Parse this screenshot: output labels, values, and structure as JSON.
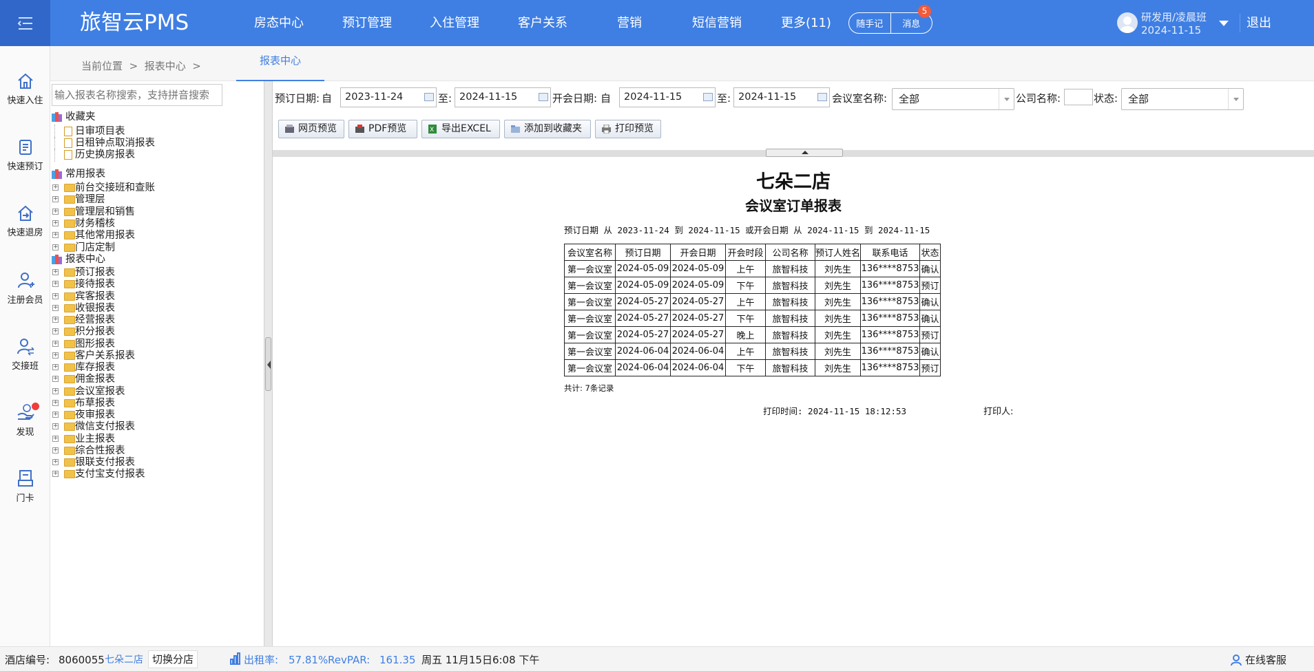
{
  "header": {
    "logo": "旅智云PMS",
    "nav": [
      "房态中心",
      "预订管理",
      "入住管理",
      "客户关系",
      "营销",
      "短信营销",
      "更多(11)"
    ],
    "memo_label": "随手记",
    "message_label": "消息",
    "message_badge": "5",
    "user_name": "研发用/凌晨班",
    "user_date": "2024-11-15",
    "logout_label": "退出",
    "accent_color": "#3f7fe3"
  },
  "quick_actions": [
    "快速入住",
    "快速预订",
    "快速退房",
    "注册会员",
    "交接班",
    "发现",
    "门卡"
  ],
  "breadcrumb": {
    "prefix": "当前位置",
    "sep": ">",
    "current": "报表中心",
    "tab": "报表中心"
  },
  "tree": {
    "search_placeholder": "输入报表名称搜索，支持拼音搜索",
    "favorites": {
      "label": "收藏夹",
      "items": [
        "日审项目表",
        "日租钟点取消报表",
        "历史换房报表"
      ]
    },
    "common": {
      "label": "常用报表",
      "items": [
        "前台交接班和查账",
        "管理层",
        "管理层和销售",
        "财务稽核",
        "其他常用报表",
        "门店定制"
      ]
    },
    "center": {
      "label": "报表中心",
      "items": [
        "预订报表",
        "接待报表",
        "宾客报表",
        "收银报表",
        "经营报表",
        "积分报表",
        "图形报表",
        "客户关系报表",
        "库存报表",
        "佣金报表",
        "会议室报表",
        "布草报表",
        "夜审报表",
        "微信支付报表",
        "业主报表",
        "综合性报表",
        "银联支付报表",
        "支付宝支付报表"
      ]
    }
  },
  "filters": {
    "booking_date_label": "预订日期:",
    "from_label": "自",
    "to_label": "至:",
    "booking_from": "2023-11-24",
    "booking_to": "2024-11-15",
    "meeting_date_label": "开会日期:",
    "meeting_from": "2024-11-15",
    "meeting_to": "2024-11-15",
    "room_label": "会议室名称:",
    "room_value": "全部",
    "company_label": "公司名称:",
    "company_value": "",
    "status_label": "状态:",
    "status_value": "全部"
  },
  "buttons": {
    "web_preview": "网页预览",
    "pdf_preview": "PDF预览",
    "export_excel": "导出EXCEL",
    "add_favorite": "添加到收藏夹",
    "print_preview": "打印预览"
  },
  "report": {
    "hotel": "七朵二店",
    "title": "会议室订单报表",
    "condition": "预订日期 从 2023-11-24 到 2024-11-15 或开会日期 从 2024-11-15 到 2024-11-15",
    "columns": [
      "会议室名称",
      "预订日期",
      "开会日期",
      "开会时段",
      "公司名称",
      "预订人姓名",
      "联系电话",
      "状态"
    ],
    "rows": [
      [
        "第一会议室",
        "2024-05-09",
        "2024-05-09",
        "上午",
        "旅智科技",
        "刘先生",
        "136****8753",
        "确认"
      ],
      [
        "第一会议室",
        "2024-05-09",
        "2024-05-09",
        "下午",
        "旅智科技",
        "刘先生",
        "136****8753",
        "预订"
      ],
      [
        "第一会议室",
        "2024-05-27",
        "2024-05-27",
        "上午",
        "旅智科技",
        "刘先生",
        "136****8753",
        "确认"
      ],
      [
        "第一会议室",
        "2024-05-27",
        "2024-05-27",
        "下午",
        "旅智科技",
        "刘先生",
        "136****8753",
        "确认"
      ],
      [
        "第一会议室",
        "2024-05-27",
        "2024-05-27",
        "晚上",
        "旅智科技",
        "刘先生",
        "136****8753",
        "预订"
      ],
      [
        "第一会议室",
        "2024-06-04",
        "2024-06-04",
        "上午",
        "旅智科技",
        "刘先生",
        "136****8753",
        "确认"
      ],
      [
        "第一会议室",
        "2024-06-04",
        "2024-06-04",
        "下午",
        "旅智科技",
        "刘先生",
        "136****8753",
        "预订"
      ]
    ],
    "total": "共计: 7条记录",
    "print_time": "打印时间: 2024-11-15 18:12:53",
    "printer": "打印人:"
  },
  "statusbar": {
    "hotel_no_label": "酒店编号:",
    "hotel_no": "8060055",
    "hotel_name": "七朵二店",
    "switch_label": "切换分店",
    "occupancy_label": "出租率:",
    "occupancy": "57.81%",
    "revpar_label": "RevPAR:",
    "revpar": "161.35",
    "datetime": "周五 11月15日6:08 下午",
    "support": "在线客服"
  }
}
